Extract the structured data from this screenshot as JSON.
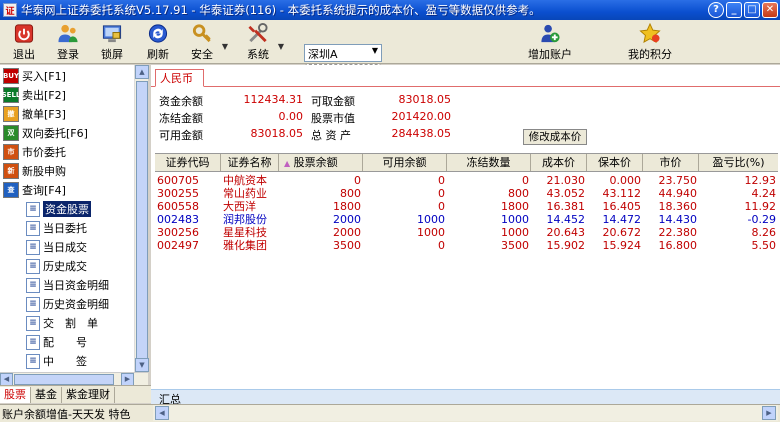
{
  "window": {
    "title": "华泰网上证券委托系统V5.17.91 - 华泰证券(116) - 本委托系统提示的成本价、盈亏等数据仅供参考。"
  },
  "toolbar": {
    "items": [
      {
        "label": "退出",
        "icon": "exit-icon"
      },
      {
        "label": "登录",
        "icon": "users-icon"
      },
      {
        "label": "锁屏",
        "icon": "lock-screen-icon"
      },
      {
        "label": "刷新",
        "icon": "refresh-icon"
      },
      {
        "label": "安全",
        "icon": "security-icon"
      },
      {
        "label": "系统",
        "icon": "tools-icon"
      }
    ],
    "market_select": "深圳A",
    "add_account": "增加账户",
    "my_points": "我的积分"
  },
  "nav": {
    "items": [
      {
        "label": "买入[F1]",
        "badge": "BUY",
        "color": "#c00000"
      },
      {
        "label": "卖出[F2]",
        "badge": "SELL",
        "color": "#0a7a2a"
      },
      {
        "label": "撤单[F3]",
        "badge": "撤",
        "color": "#c08000"
      },
      {
        "label": "双向委托[F6]",
        "badge": "双",
        "color": "#1a6a1a"
      },
      {
        "label": "市价委托",
        "badge": "市",
        "color": "#c04000"
      },
      {
        "label": "新股申购",
        "badge": "新",
        "color": "#c04000"
      },
      {
        "label": "查询[F4]",
        "badge": "查",
        "color": "#2060c0"
      }
    ],
    "sub_items": [
      {
        "label": "资金股票",
        "selected": true
      },
      {
        "label": "当日委托"
      },
      {
        "label": "当日成交"
      },
      {
        "label": "历史成交"
      },
      {
        "label": "当日资金明细"
      },
      {
        "label": "历史资金明细"
      },
      {
        "label": "交　割　单"
      },
      {
        "label": "配　　号"
      },
      {
        "label": "中　　签"
      }
    ],
    "bottom_tabs": [
      "股票",
      "基金",
      "紫金理财"
    ]
  },
  "status": {
    "text": "账户余额增值-天天发",
    "extra": "特色"
  },
  "main": {
    "currency_tab": "人民币",
    "summary": [
      {
        "label": "资金余额",
        "value": "112434.31"
      },
      {
        "label": "冻结金额",
        "value": "0.00"
      },
      {
        "label": "可用金额",
        "value": "83018.05"
      },
      {
        "label": "可取金额",
        "value": "83018.05"
      },
      {
        "label": "股票市值",
        "value": "201420.00"
      },
      {
        "label": "总 资 产",
        "value": "284438.05"
      }
    ],
    "modify_cost_button": "修改成本价",
    "columns": [
      "证券代码",
      "证券名称",
      "股票余额",
      "可用余额",
      "冻结数量",
      "成本价",
      "保本价",
      "市价",
      "盈亏比(%)"
    ],
    "sort_marker": "▲",
    "rows": [
      [
        "600705",
        "中航资本",
        "0",
        "0",
        "0",
        "21.030",
        "0.000",
        "23.750",
        "12.93"
      ],
      [
        "300255",
        "常山药业",
        "800",
        "0",
        "800",
        "43.052",
        "43.112",
        "44.940",
        "4.24"
      ],
      [
        "600558",
        "大西洋",
        "1800",
        "0",
        "1800",
        "16.381",
        "16.405",
        "18.360",
        "11.92"
      ],
      [
        "002483",
        "润邦股份",
        "2000",
        "1000",
        "1000",
        "14.452",
        "14.472",
        "14.430",
        "-0.29"
      ],
      [
        "300256",
        "星星科技",
        "2000",
        "1000",
        "1000",
        "20.643",
        "20.672",
        "22.380",
        "8.26"
      ],
      [
        "002497",
        "雅化集团",
        "3500",
        "0",
        "3500",
        "15.902",
        "15.924",
        "16.800",
        "5.50"
      ]
    ],
    "row_colors": [
      "#c00000",
      "#c00000",
      "#c00000",
      "#0000c0",
      "#c00000",
      "#c00000"
    ],
    "total_label": "汇总"
  }
}
